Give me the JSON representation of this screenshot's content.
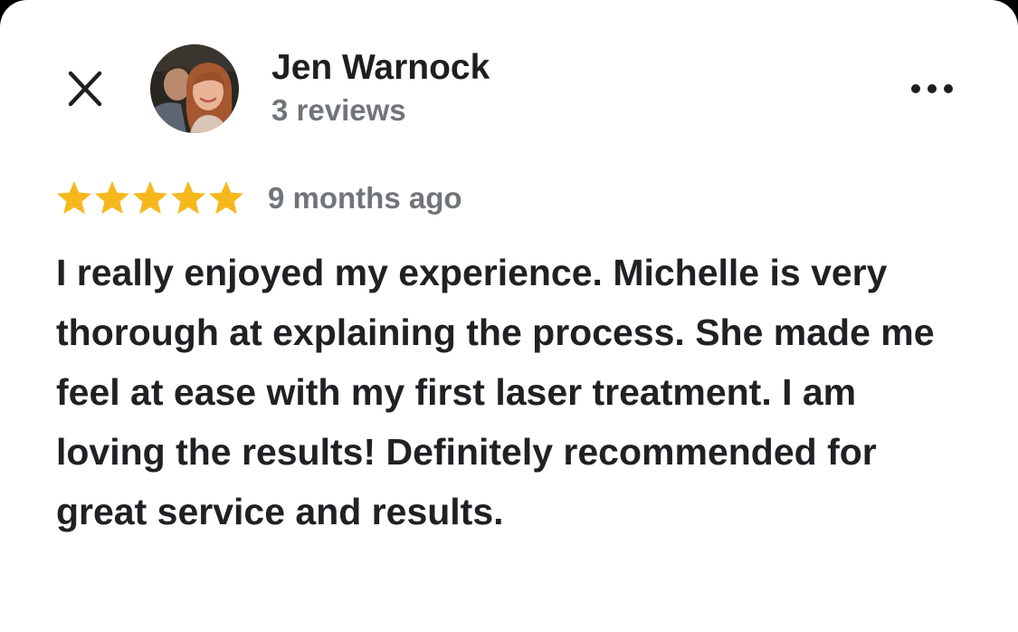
{
  "reviewer": {
    "name": "Jen Warnock",
    "review_count": "3 reviews",
    "avatar_icon": "avatar-photo"
  },
  "header": {
    "close_icon": "close-icon",
    "more_icon": "more-options-icon"
  },
  "review": {
    "rating": 5,
    "rating_max": 5,
    "star_color": "#f6b81d",
    "time_ago": "9 months ago",
    "text": "I really enjoyed my experience. Michelle is very thorough at explaining the process. She made me feel at ease with my first laser treatment. I am loving the results! Definitely recommended for great service and results."
  }
}
